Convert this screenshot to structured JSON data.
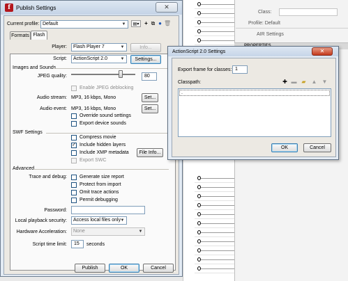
{
  "background": {
    "properties": {
      "class_label": "Class:",
      "profile_label": "Profile: Default",
      "air_settings": "AIR Settings",
      "properties_header": "PROPERTIES"
    }
  },
  "publish_settings": {
    "title": "Publish Settings",
    "close_glyph": "✕",
    "current_profile_label": "Current profile:",
    "current_profile_value": "Default",
    "tabs": [
      {
        "label": "Formats"
      },
      {
        "label": "Flash"
      }
    ],
    "player_label": "Player:",
    "player_value": "Flash Player 7",
    "info_button": "Info...",
    "script_label": "Script:",
    "script_value": "ActionScript 2.0",
    "settings_button": "Settings...",
    "images_section": "Images and Sounds",
    "jpeg_quality_label": "JPEG quality:",
    "jpeg_quality_value": "80",
    "jpeg_quality_fraction": 0.8,
    "enable_jpeg_deblocking": "Enable JPEG deblocking",
    "audio_stream_label": "Audio stream:",
    "audio_stream_value": "MP3, 16 kbps, Mono",
    "audio_event_label": "Audio event:",
    "audio_event_value": "MP3, 16 kbps, Mono",
    "set_button": "Set...",
    "override_sound": "Override sound settings",
    "export_device_sounds": "Export device sounds",
    "swf_section": "SWF Settings",
    "compress_movie": "Compress movie",
    "include_hidden_layers": "Include hidden layers",
    "include_xmp": "Include XMP metadata",
    "file_info_button": "File Info...",
    "export_swc": "Export SWC",
    "advanced_section": "Advanced",
    "trace_debug_label": "Trace and debug:",
    "generate_size_report": "Generate size report",
    "protect_from_import": "Protect from import",
    "omit_trace_actions": "Omit trace actions",
    "permit_debugging": "Permit debugging",
    "password_label": "Password:",
    "local_playback_label": "Local playback security:",
    "local_playback_value": "Access local files only",
    "hardware_accel_label": "Hardware Acceleration:",
    "hardware_accel_value": "None",
    "script_time_limit_label": "Script time limit:",
    "script_time_limit_value": "15",
    "seconds_label": "seconds",
    "publish_button": "Publish",
    "ok_button": "OK",
    "cancel_button": "Cancel",
    "checked_glyph": "✓"
  },
  "as_settings": {
    "title": "ActionScript 2.0 Settings",
    "close_glyph": "✕",
    "export_frame_label": "Export frame for classes:",
    "export_frame_value": "1",
    "classpath_label": "Classpath:",
    "classpath_items": [
      "."
    ],
    "ok_button": "OK",
    "cancel_button": "Cancel"
  }
}
